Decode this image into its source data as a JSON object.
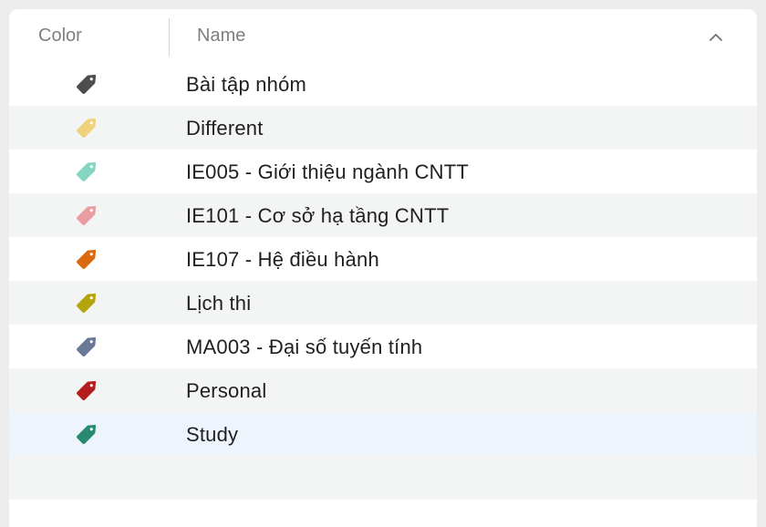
{
  "header": {
    "color_label": "Color",
    "name_label": "Name"
  },
  "sort": {
    "direction": "ascending",
    "icon": "chevron-up-icon"
  },
  "tags": [
    {
      "name": "Bài tập nhóm",
      "color": "#4d4d4d"
    },
    {
      "name": "Different",
      "color": "#f0d27a"
    },
    {
      "name": "IE005 - Giới thiệu ngành CNTT",
      "color": "#84d6c1"
    },
    {
      "name": "IE101 - Cơ sở hạ tầng CNTT",
      "color": "#e89da0"
    },
    {
      "name": "IE107 - Hệ điều hành",
      "color": "#db690f"
    },
    {
      "name": "Lịch thi",
      "color": "#b4a50c"
    },
    {
      "name": "MA003 - Đại số tuyến tính",
      "color": "#6a7a96"
    },
    {
      "name": "Personal",
      "color": "#b51c1c"
    },
    {
      "name": "Study",
      "color": "#2a8a6f"
    }
  ],
  "selected_index": 8
}
